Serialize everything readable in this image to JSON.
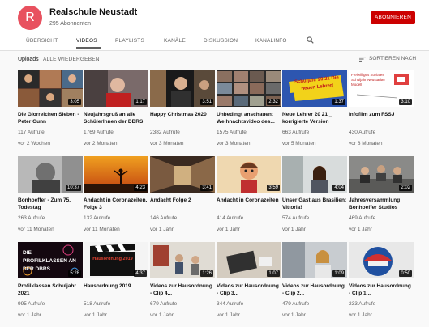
{
  "channel": {
    "avatar_letter": "R",
    "name": "Realschule Neustadt",
    "subscribers": "295 Abonnenten",
    "subscribe_label": "ABONNIEREN"
  },
  "tabs": [
    "ÜBERSICHT",
    "VIDEOS",
    "PLAYLISTS",
    "KANÄLE",
    "DISKUSSION",
    "KANALINFO"
  ],
  "active_tab": "VIDEOS",
  "toolbar": {
    "uploads_label": "Uploads",
    "all_label": "ALLE WIEDERGEBEN",
    "sort_label": "SORTIEREN NACH"
  },
  "videos": [
    {
      "title": "Die Glorreichen Sieben - Peter Gunn",
      "views": "117 Aufrufe",
      "age": "vor 2 Wochen",
      "duration": "3:05",
      "thumb_text": ""
    },
    {
      "title": "Neujahrsgruß an alle SchülerInnen der DBRS",
      "views": "1769 Aufrufe",
      "age": "vor 2 Monaten",
      "duration": "1:17",
      "thumb_text": ""
    },
    {
      "title": "Happy Christmas 2020",
      "views": "2382 Aufrufe",
      "age": "vor 3 Monaten",
      "duration": "3:51",
      "thumb_text": ""
    },
    {
      "title": "Unbedingt anschauen: Weihnachtsvideo des...",
      "views": "1575 Aufrufe",
      "age": "vor 3 Monaten",
      "duration": "2:32",
      "thumb_text": ""
    },
    {
      "title": "Neue Lehrer 20 21 _ korrigierte Version",
      "views": "663 Aufrufe",
      "age": "vor 5 Monaten",
      "duration": "1:37",
      "thumb_text": "Schuljahr 20.21 Die neuen Lehrer!"
    },
    {
      "title": "Infofilm zum FSSJ",
      "views": "430 Aufrufe",
      "age": "vor 8 Monaten",
      "duration": "3:10",
      "thumb_text": "Freiwilliges Soziales Schuljahr Neustädter Modell"
    },
    {
      "title": "Bonhoeffer - Zum 75. Todestag",
      "views": "263 Aufrufe",
      "age": "vor 11 Monaten",
      "duration": "10:37",
      "thumb_text": ""
    },
    {
      "title": "Andacht in Coronazeiten, Folge 3",
      "views": "132 Aufrufe",
      "age": "vor 11 Monaten",
      "duration": "4:23",
      "thumb_text": ""
    },
    {
      "title": "Andacht Folge 2",
      "views": "146 Aufrufe",
      "age": "vor 1 Jahr",
      "duration": "3:41",
      "thumb_text": ""
    },
    {
      "title": "Andacht in Coronazeiten",
      "views": "414 Aufrufe",
      "age": "vor 1 Jahr",
      "duration": "3:59",
      "thumb_text": ""
    },
    {
      "title": "Unser Gast aus Brasilien: Vittoria!",
      "views": "574 Aufrufe",
      "age": "vor 1 Jahr",
      "duration": "4:04",
      "thumb_text": ""
    },
    {
      "title": "Jahresversammlung Bonhoeffer Studios",
      "views": "469 Aufrufe",
      "age": "vor 1 Jahr",
      "duration": "2:02",
      "thumb_text": ""
    },
    {
      "title": "Profilklassen Schuljahr 2021",
      "views": "995 Aufrufe",
      "age": "vor 1 Jahr",
      "duration": "5:28",
      "thumb_text": "DIE PROFILKLASSEN AN DER DBRS"
    },
    {
      "title": "Hausordnung 2019",
      "views": "518 Aufrufe",
      "age": "vor 1 Jahr",
      "duration": "4:37",
      "thumb_text": "Hausordnung 2019"
    },
    {
      "title": "Videos zur Hausordnung - Clip 4...",
      "views": "679 Aufrufe",
      "age": "vor 1 Jahr",
      "duration": "1:26",
      "thumb_text": ""
    },
    {
      "title": "Videos zur Hausordnung - Clip 3...",
      "views": "344 Aufrufe",
      "age": "vor 1 Jahr",
      "duration": "1:07",
      "thumb_text": ""
    },
    {
      "title": "Videos zur Hausordnung - Clip 2...",
      "views": "479 Aufrufe",
      "age": "vor 1 Jahr",
      "duration": "1:09",
      "thumb_text": ""
    },
    {
      "title": "Videos zur Hausordnung - Clip 1...",
      "views": "233 Aufrufe",
      "age": "vor 1 Jahr",
      "duration": "0:50",
      "thumb_text": ""
    }
  ],
  "colors": {
    "subscribe": "#cc0000",
    "avatar": "#e8515f"
  }
}
